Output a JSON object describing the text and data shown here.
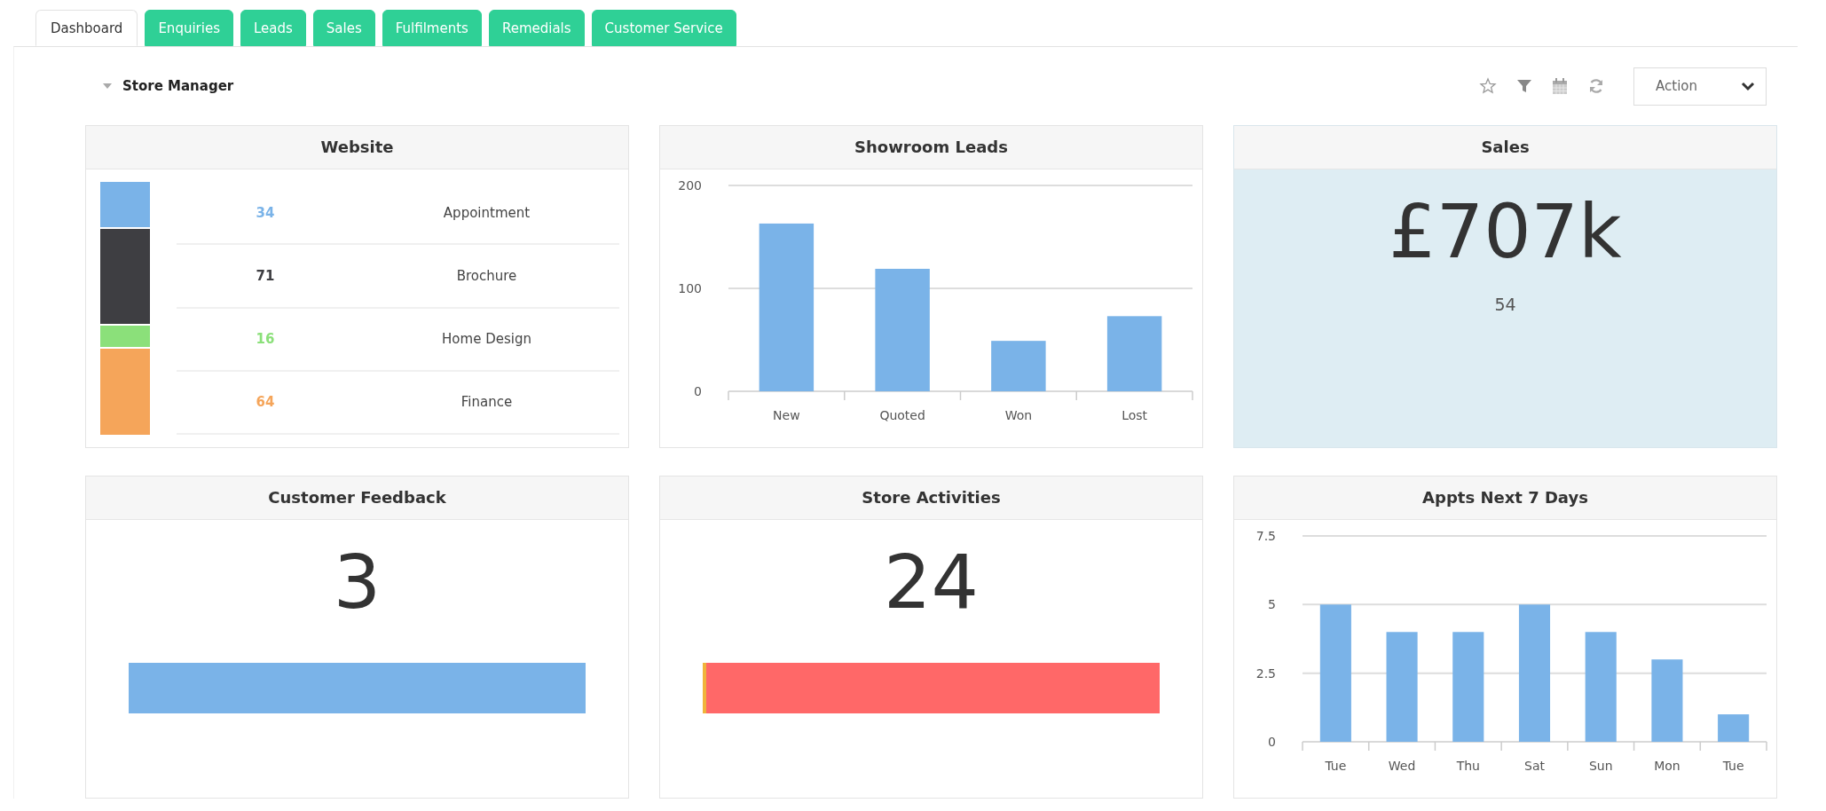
{
  "tabs": [
    {
      "label": "Dashboard",
      "selected": true
    },
    {
      "label": "Enquiries",
      "selected": false
    },
    {
      "label": "Leads",
      "selected": false
    },
    {
      "label": "Sales",
      "selected": false
    },
    {
      "label": "Fulfilments",
      "selected": false
    },
    {
      "label": "Remedials",
      "selected": false
    },
    {
      "label": "Customer Service",
      "selected": false
    }
  ],
  "section": {
    "title": "Store Manager",
    "expanded": true
  },
  "toolbar": {
    "action_label": "Action"
  },
  "panels": [
    {
      "kind": "breakdown",
      "title": "Website",
      "items": [
        {
          "value": "34",
          "label": "Appointment",
          "color": "#7ab3e8"
        },
        {
          "value": "71",
          "label": "Brochure",
          "color": "#3e3e42"
        },
        {
          "value": "16",
          "label": "Home Design",
          "color": "#8be07a"
        },
        {
          "value": "64",
          "label": "Finance",
          "color": "#f5a55a"
        }
      ]
    },
    {
      "kind": "chart",
      "title": "Showroom Leads",
      "chart_data": {
        "type": "bar",
        "categories": [
          "New",
          "Quoted",
          "Won",
          "Lost"
        ],
        "series": [
          {
            "color": "#7ab3e8",
            "values": [
              163,
              119,
              49,
              73
            ]
          }
        ],
        "ylim": [
          0,
          200
        ],
        "yticks": [
          0,
          100,
          200
        ]
      }
    },
    {
      "kind": "kpi",
      "title": "Sales",
      "value": "£707k",
      "subvalue": "54"
    },
    {
      "kind": "meter",
      "title": "Customer Feedback",
      "value": "3",
      "segments": [
        {
          "color": "#7ab3e8",
          "level": 1
        }
      ]
    },
    {
      "kind": "meter",
      "title": "Store Activities",
      "value": "24",
      "segments": [
        {
          "color": "#f0b43c",
          "level": 0.008
        },
        {
          "color": "#ff6868",
          "level": 0.992
        }
      ]
    },
    {
      "kind": "chart",
      "title": "Appts Next 7 Days",
      "chart_data": {
        "type": "bar",
        "categories": [
          "Tue",
          "Wed",
          "Thu",
          "Sat",
          "Sun",
          "Mon",
          "Tue"
        ],
        "series": [
          {
            "color": "#7ab3e8",
            "values": [
              5,
              4,
              4,
              5,
              4,
              3,
              1
            ]
          }
        ],
        "ylim": [
          0,
          7.5
        ],
        "yticks": [
          0,
          2.5,
          5,
          7.5
        ]
      }
    }
  ]
}
